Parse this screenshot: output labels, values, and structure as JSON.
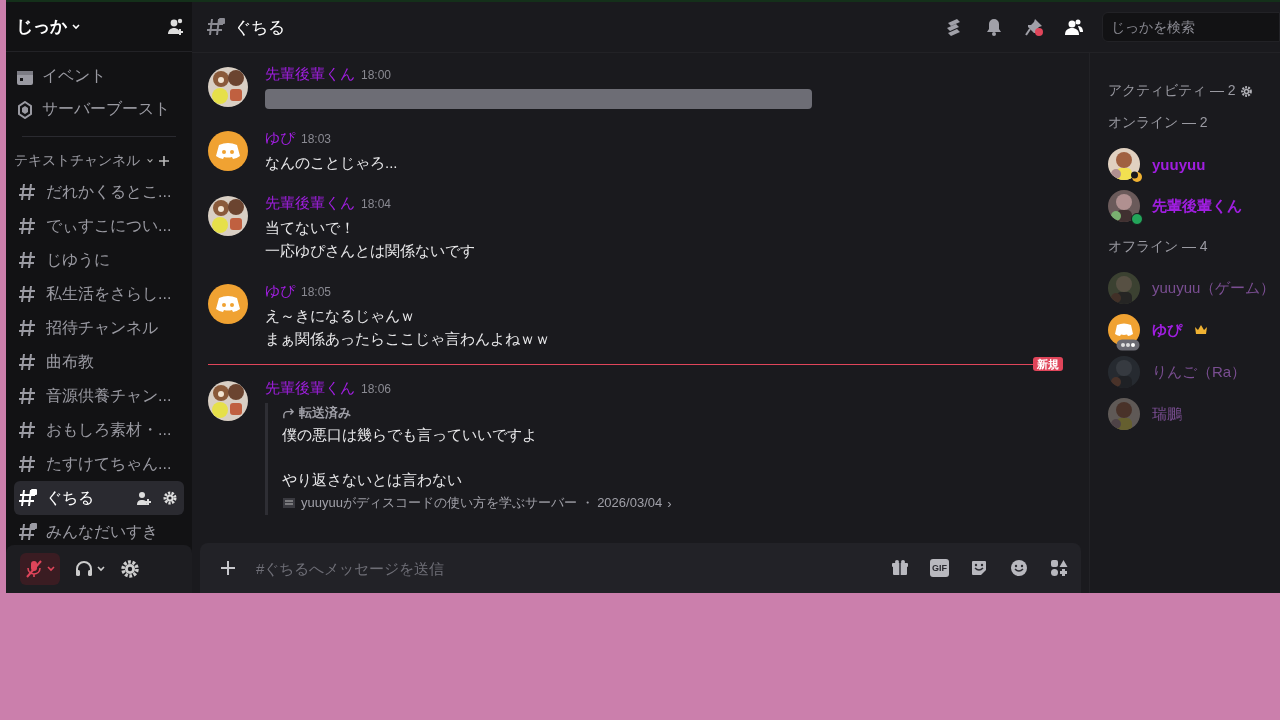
{
  "server": {
    "name": "じっか"
  },
  "sidebar": {
    "items": [
      {
        "label": "イベント",
        "kind": "events"
      },
      {
        "label": "サーバーブースト",
        "kind": "boost"
      }
    ],
    "category": "テキストチャンネル",
    "channels": [
      {
        "name": "だれかくるとこ...",
        "private": false,
        "selected": false
      },
      {
        "name": "でぃすこについ...",
        "private": false,
        "selected": false
      },
      {
        "name": "じゆうに",
        "private": false,
        "selected": false
      },
      {
        "name": "私生活をさらし...",
        "private": false,
        "selected": false
      },
      {
        "name": "招待チャンネル",
        "private": false,
        "selected": false
      },
      {
        "name": "曲布教",
        "private": false,
        "selected": false
      },
      {
        "name": "音源供養チャン...",
        "private": false,
        "selected": false
      },
      {
        "name": "おもしろ素材・...",
        "private": false,
        "selected": false
      },
      {
        "name": "たすけてちゃん...",
        "private": false,
        "selected": false
      },
      {
        "name": "ぐちる",
        "private": true,
        "selected": true
      },
      {
        "name": "みんなだいすき",
        "private": true,
        "selected": false
      }
    ]
  },
  "user_panel": {
    "muted": true
  },
  "channel_header": {
    "name": "ぐちる",
    "pin_unread": true,
    "members_open": true
  },
  "messages": [
    {
      "author": "先輩後輩くん",
      "avatar": {
        "kind": "picture"
      },
      "time": "18:00",
      "kind": "blurred"
    },
    {
      "author": "ゆぴ",
      "avatar": {
        "kind": "logo"
      },
      "time": "18:03",
      "kind": "text",
      "lines": [
        "なんのことじゃろ..."
      ]
    },
    {
      "author": "先輩後輩くん",
      "avatar": {
        "kind": "picture"
      },
      "time": "18:04",
      "kind": "text",
      "lines": [
        "当てないで！",
        "一応ゆぴさんとは関係ないです"
      ]
    },
    {
      "author": "ゆぴ",
      "avatar": {
        "kind": "logo"
      },
      "time": "18:05",
      "kind": "text",
      "lines": [
        "え～きになるじゃんｗ",
        "まぁ関係あったらここじゃ言わんよねｗｗ"
      ]
    },
    {
      "author": "先輩後輩くん",
      "avatar": {
        "kind": "picture"
      },
      "time": "18:06",
      "kind": "forwarded",
      "new_divider": "新規",
      "forward_label": "転送済み",
      "paragraphs": [
        "僕の悪口は幾らでも言っていいですよ",
        "やり返さないとは言わない"
      ],
      "source": "yuuyuuがディスコードの使い方を学ぶサーバー ・ 2026/03/04",
      "source_arrow": "›"
    }
  ],
  "composer": {
    "placeholder": "#ぐちるへメッセージを送信",
    "gif_label": "GIF"
  },
  "search": {
    "placeholder": "じっかを検索"
  },
  "members": {
    "sections": [
      {
        "title": "アクティビティ — 2",
        "kind": "activity"
      },
      {
        "title": "オンライン — 2",
        "kind": "list",
        "members": [
          {
            "name": "yuuyuu",
            "avatar": {
              "kind": "picture"
            },
            "status": {
              "kind": "idle"
            },
            "offline": false,
            "owner": false
          },
          {
            "name": "先輩後輩くん",
            "avatar": {
              "kind": "picture"
            },
            "status": {
              "kind": "online"
            },
            "offline": false,
            "owner": false
          }
        ]
      },
      {
        "title": "オフライン — 4",
        "kind": "list",
        "members": [
          {
            "name": "yuuyuu（ゲーム）",
            "avatar": {
              "kind": "picture"
            },
            "offline": true,
            "owner": false
          },
          {
            "name": "ゆぴ",
            "avatar": {
              "kind": "logo"
            },
            "status": {
              "kind": "activity"
            },
            "offline": false,
            "owner": true
          },
          {
            "name": "りんご（Ra）",
            "avatar": {
              "kind": "picture"
            },
            "offline": true,
            "owner": false
          },
          {
            "name": "瑞鵬",
            "avatar": {
              "kind": "picture"
            },
            "offline": true,
            "owner": false
          }
        ]
      }
    ]
  }
}
